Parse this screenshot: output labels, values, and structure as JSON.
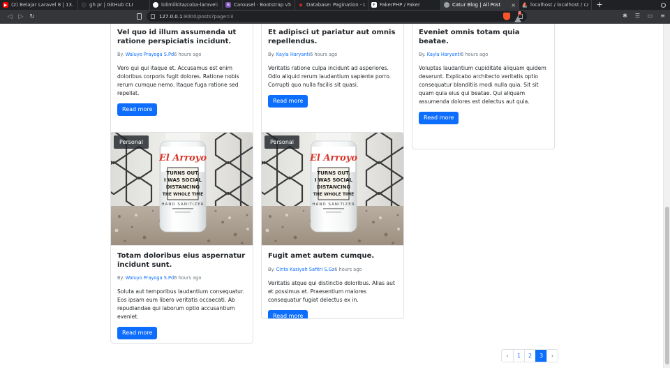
{
  "browser": {
    "tabs": [
      {
        "title": "(2) Belajar Laravel 8 | 13. S",
        "icon": "youtube-icon",
        "color": "#ff0000",
        "active": false
      },
      {
        "title": "gh pr | GitHub CLI",
        "icon": "github-icon",
        "color": "#333333",
        "active": false
      },
      {
        "title": "lolimilkita/coba-laravel: B",
        "icon": "github-icon",
        "color": "#ffffff",
        "active": false
      },
      {
        "title": "Carousel · Bootstrap v5.2",
        "icon": "bootstrap-icon",
        "color": "#7952b3",
        "active": false
      },
      {
        "title": "Database: Pagination - La",
        "icon": "laravel-icon",
        "color": "#ff2d20",
        "active": false
      },
      {
        "title": "FakerPHP / Faker",
        "icon": "faker-icon",
        "color": "#ffffff",
        "active": false
      },
      {
        "title": "Catur Blog | All Post",
        "icon": "globe-icon",
        "color": "#9aa0a6",
        "active": true
      },
      {
        "title": "localhost / localhost / catu",
        "icon": "phpmyadmin-icon",
        "color": "#f89c0e",
        "active": false
      }
    ],
    "url_host": "127.0.0.1",
    "url_rest": ":8000/posts?page=3",
    "brave_badge": "8"
  },
  "posts_top": [
    {
      "title": "Vel quo id illum assumenda ut ratione perspiciatis incidunt.",
      "by": "By.",
      "author": "Waluyo Prayoga S.Pd",
      "time": "6 hours ago",
      "excerpt": "Vero qui qui itaque et. Accusamus est enim doloribus corporis fugit dolores. Ratione nobis rerum cumque nemo. Itaque fuga ratione sed repellat.",
      "button": "Read more"
    },
    {
      "title": "Et adipisci ut pariatur aut omnis repellendus.",
      "by": "By.",
      "author": "Kayla Haryanti",
      "time": "6 hours ago",
      "excerpt": "Veritatis ratione culpa incidunt ad asperiores. Odio aliquid rerum laudantium sapiente porro. Corrupti quo nulla facilis sit quasi.",
      "button": "Read more"
    },
    {
      "title": "Eveniet omnis totam quia beatae.",
      "by": "By.",
      "author": "Kayla Haryanti",
      "time": "6 hours ago",
      "excerpt": "Voluptas laudantium cupiditate aliquam quidem deserunt. Explicabo architecto veritatis optio consequatur blanditiis modi nulla quia. Sit sit quam quia eius qui beatae. Qui aliquam assumenda dolores est delectus aut quia.",
      "button": "Read more"
    }
  ],
  "posts_bottom": [
    {
      "category": "Personal",
      "title": "Totam doloribus eius aspernatur incidunt sunt.",
      "by": "By.",
      "author": "Waluyo Prayoga S.Pd",
      "time": "6 hours ago",
      "excerpt": "Soluta aut temporibus laudantium consequatur. Eos ipsam eum libero veritatis occaecati. Ab repudiandae qui laborum optio accusantium eveniet.",
      "button": "Read more"
    },
    {
      "category": "Personal",
      "title": "Fugit amet autem cumque.",
      "by": "By.",
      "author": "Cinta Kasiyah Safitri S.Gz",
      "time": "6 hours ago",
      "excerpt": "Veritatis atque qui distinctio doloribus. Alias aut et possimus et. Praesentium maiores consequatur fugiat delectus ex in.",
      "button": "Read more"
    }
  ],
  "bottle_label": {
    "brand": "El Arroyo",
    "line1": "TURNS OUT,",
    "line2": "I WAS SOCIAL",
    "line3": "DISTANCING",
    "line4": "THE WHOLE TIME",
    "product": "HAND SANITIZER"
  },
  "pagination": {
    "prev": "‹",
    "pages": [
      "1",
      "2",
      "3"
    ],
    "active": "3",
    "next": "›"
  },
  "colors": {
    "primary": "#0d6efd",
    "badge_bg": "#212529",
    "brand_red": "#d7362b"
  }
}
